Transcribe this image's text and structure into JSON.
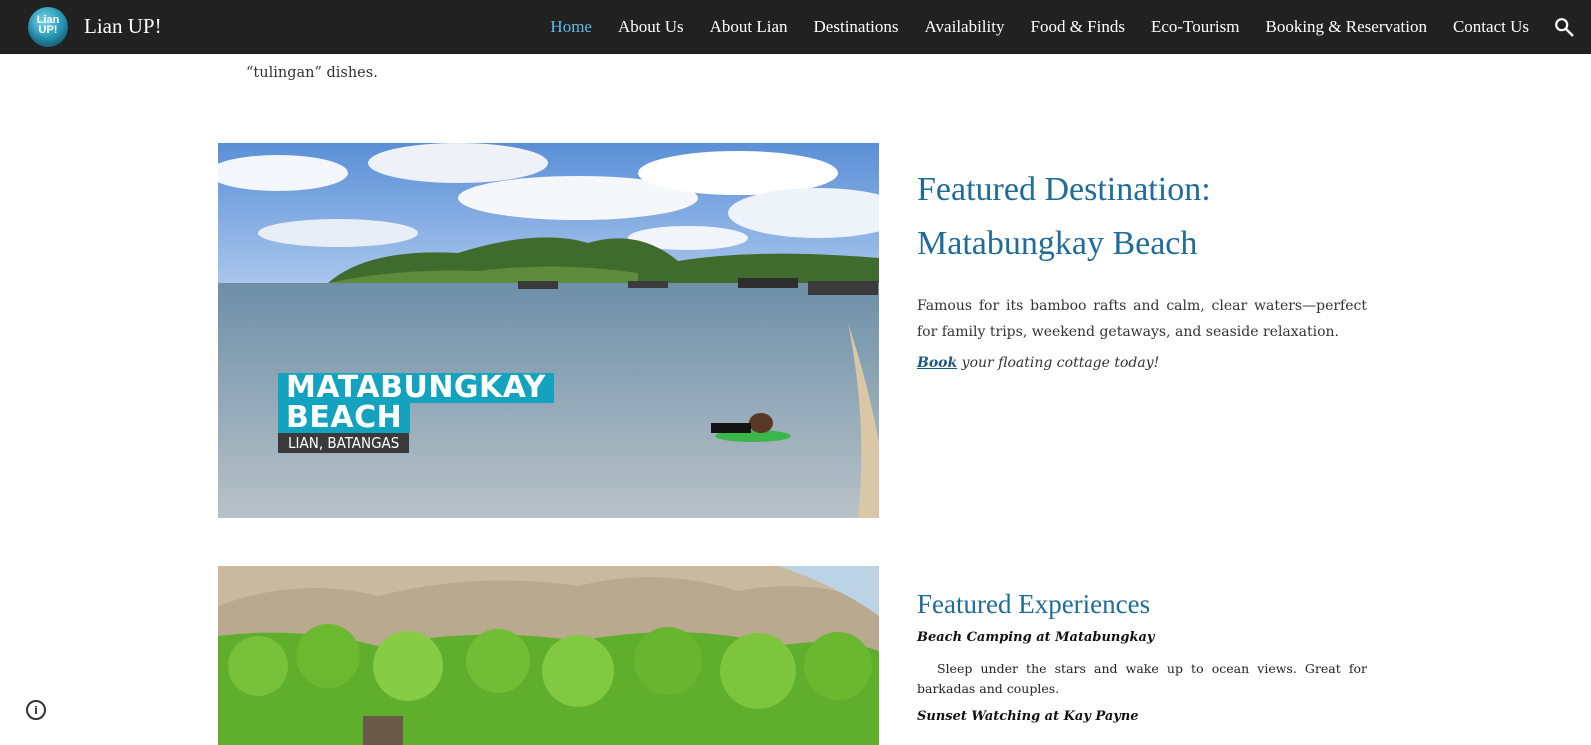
{
  "header": {
    "logo_text": "Lian UP!",
    "site_title": "Lian UP!",
    "nav": [
      {
        "label": "Home",
        "active": true
      },
      {
        "label": "About Us"
      },
      {
        "label": "About Lian"
      },
      {
        "label": "Destinations"
      },
      {
        "label": "Availability"
      },
      {
        "label": "Food & Finds"
      },
      {
        "label": "Eco-Tourism"
      },
      {
        "label": "Booking & Reservation"
      },
      {
        "label": "Contact Us"
      }
    ],
    "search_icon": "search-icon"
  },
  "remnant": {
    "line": "“tulingan” dishes."
  },
  "beach_image": {
    "badge_title_line1": "MATABUNGKAY",
    "badge_title_line2": "BEACH",
    "badge_subtitle": "LIAN, BATANGAS"
  },
  "featured_destination": {
    "heading_line1": "Featured Destination:",
    "heading_line2": "Matabungkay Beach",
    "description": "Famous for its bamboo rafts and calm, clear waters—perfect for family trips, weekend getaways, and seaside relaxation.",
    "book_link": "Book",
    "book_text": " your floating cottage today!"
  },
  "featured_experiences": {
    "heading": "Featured Experiences",
    "item1_title": "Beach Camping at Matabungkay",
    "item1_desc": "Sleep under the stars and wake up to ocean views. Great for barkadas and couples.",
    "item2_title": "Sunset Watching at Kay Payne"
  },
  "footer": {
    "info_icon": "info-icon"
  },
  "colors": {
    "header_bg": "#212121",
    "active_nav": "#5fb8e8",
    "heading": "#1f6b9a",
    "badge_teal": "#13a3bf"
  }
}
